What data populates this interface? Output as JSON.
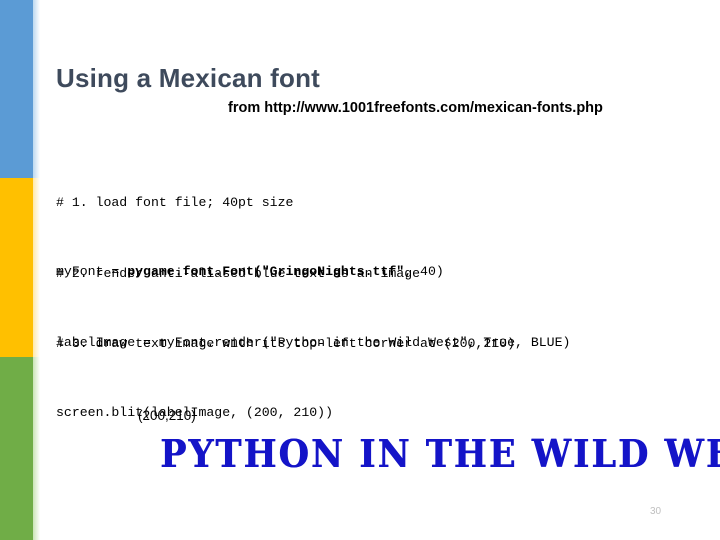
{
  "slide": {
    "title": "Using a Mexican font",
    "subtitle": "from http://www.1001freefonts.com/mexican-fonts.php",
    "number": "30"
  },
  "sidebar": {
    "bands": [
      {
        "name": "blue",
        "color": "#5b9bd5"
      },
      {
        "name": "yellow",
        "color": "#ffc000"
      },
      {
        "name": "green",
        "color": "#70ad47"
      }
    ]
  },
  "code_blocks": [
    {
      "id": "block-1",
      "comment": "# 1. load font file; 40pt size",
      "statement_prefix": "myFont = ",
      "statement_bold": "pygame.font.Font(\"GringoNights.ttf\"",
      "statement_suffix": ", 40)"
    },
    {
      "id": "block-2",
      "comment": "# 2. render anti-aliased blue text as an image",
      "statement": "labelImage = myFont.render(\"Python in the Wild West\", True, BLUE)"
    },
    {
      "id": "block-3",
      "comment": "# 3. draw text image with its top-left corner at (200,210)",
      "statement": "screen.blit(labelImage, (200, 210))"
    }
  ],
  "output_demo": {
    "coordinate_label": "(200,210)",
    "rendered_text": "PYTHON IN THE WILD WEST",
    "rendered_text_color": "#1414c8"
  }
}
